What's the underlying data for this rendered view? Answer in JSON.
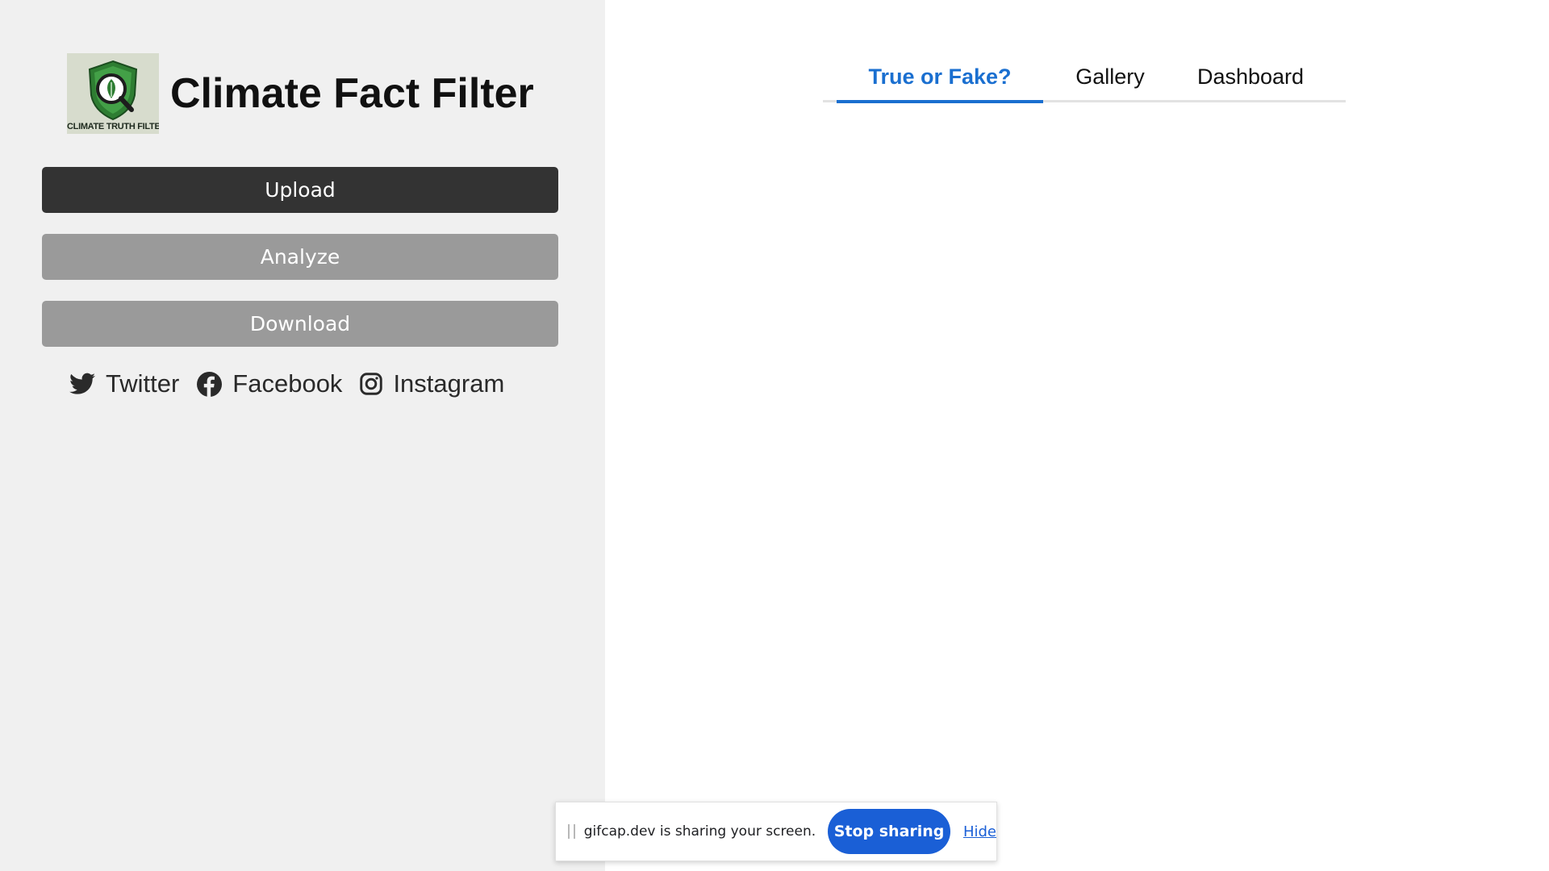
{
  "sidebar": {
    "title": "Climate Fact Filter",
    "logo_text": "CLIMATE TRUTH FILTER",
    "buttons": {
      "upload": "Upload",
      "analyze": "Analyze",
      "download": "Download"
    },
    "social": [
      {
        "label": "Twitter",
        "icon": "twitter-icon"
      },
      {
        "label": "Facebook",
        "icon": "facebook-icon"
      },
      {
        "label": "Instagram",
        "icon": "instagram-icon"
      }
    ]
  },
  "tabs": [
    {
      "label": "True or Fake?",
      "active": true
    },
    {
      "label": "Gallery",
      "active": false
    },
    {
      "label": "Dashboard",
      "active": false
    }
  ],
  "share_bar": {
    "message": "gifcap.dev is sharing your screen.",
    "stop_label": "Stop sharing",
    "hide_label": "Hide"
  },
  "colors": {
    "accent": "#1a6fd0",
    "sidebar_bg": "#f0f0f0",
    "primary_button": "#333333",
    "disabled_button": "#9a9a9a",
    "stop_button": "#1a5fd6"
  }
}
